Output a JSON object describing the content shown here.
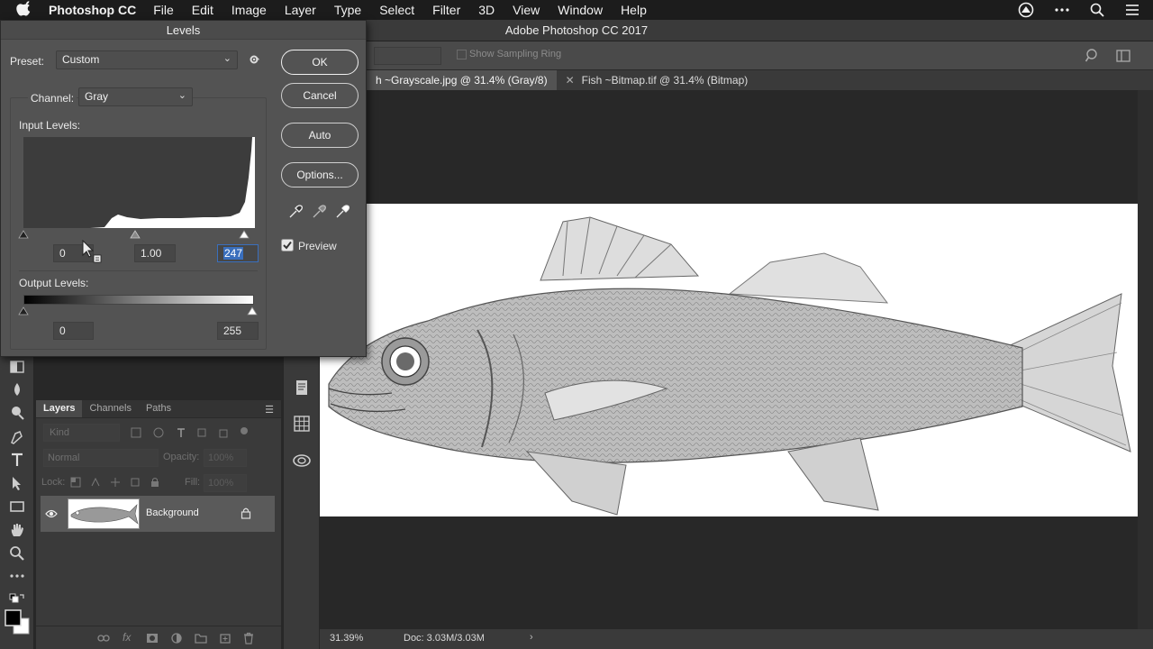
{
  "menubar": {
    "app_name": "Photoshop CC",
    "items": [
      "File",
      "Edit",
      "Image",
      "Layer",
      "Type",
      "Select",
      "Filter",
      "3D",
      "View",
      "Window",
      "Help"
    ]
  },
  "app_title": "Adobe Photoshop CC 2017",
  "options_bar": {
    "sampling_ring_label": "Show Sampling Ring"
  },
  "tabs": [
    {
      "label": "h ~Grayscale.jpg @ 31.4% (Gray/8)",
      "active": true
    },
    {
      "label": "Fish ~Bitmap.tif @ 31.4% (Bitmap)",
      "active": false
    }
  ],
  "status": {
    "zoom": "31.39%",
    "doc": "Doc: 3.03M/3.03M",
    "arrow": "›"
  },
  "levels": {
    "title": "Levels",
    "preset_label": "Preset:",
    "preset_value": "Custom",
    "channel_label": "Channel:",
    "channel_value": "Gray",
    "input_levels_label": "Input Levels:",
    "input_black": "0",
    "input_gamma": "1.00",
    "input_white": "247",
    "output_levels_label": "Output Levels:",
    "output_black": "0",
    "output_white": "255",
    "buttons": {
      "ok": "OK",
      "cancel": "Cancel",
      "auto": "Auto",
      "options": "Options..."
    },
    "preview_label": "Preview",
    "preview_checked": true
  },
  "layers_panel": {
    "tabs": [
      "Layers",
      "Channels",
      "Paths"
    ],
    "kind_placeholder": "Kind",
    "blend_mode": "Normal",
    "opacity_label": "Opacity:",
    "opacity_value": "100%",
    "lock_label": "Lock:",
    "fill_label": "Fill:",
    "fill_value": "100%",
    "layer_name": "Background"
  },
  "icons": [
    "apple-icon",
    "creative-cloud-icon",
    "more-icon",
    "search-icon",
    "list-icon",
    "gear-icon",
    "eyedropper-icon",
    "eye-icon",
    "lock-icon",
    "histogram-icon"
  ]
}
